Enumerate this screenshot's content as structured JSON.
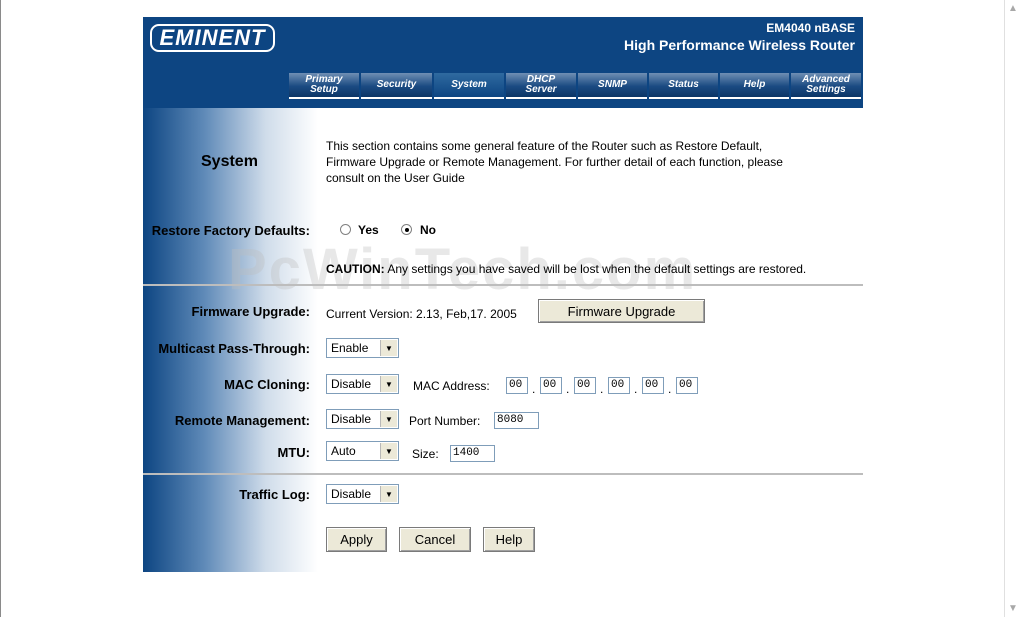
{
  "header": {
    "brand": "EMINENT",
    "model": "EM4040 nBASE",
    "subtitle": "High Performance Wireless Router"
  },
  "tabs": [
    {
      "line1": "Primary",
      "line2": "Setup"
    },
    {
      "line1": "Security",
      "line2": ""
    },
    {
      "line1": "System",
      "line2": ""
    },
    {
      "line1": "DHCP",
      "line2": "Server"
    },
    {
      "line1": "SNMP",
      "line2": ""
    },
    {
      "line1": "Status",
      "line2": ""
    },
    {
      "line1": "Help",
      "line2": ""
    },
    {
      "line1": "Advanced",
      "line2": "Settings"
    }
  ],
  "active_tab": "System",
  "section": {
    "title": "System",
    "description": [
      "This section contains some general feature of the Router such as Restore Default,",
      "Firmware Upgrade or Remote Management. For further detail of each function, please",
      "consult on the User Guide"
    ]
  },
  "restore": {
    "label": "Restore Factory Defaults:",
    "yes": "Yes",
    "no": "No",
    "selected": "No",
    "caution_label": "CAUTION:",
    "caution_text": "Any settings you have saved will be lost when the default settings are restored."
  },
  "firmware": {
    "label": "Firmware Upgrade:",
    "version_text": "Current Version: 2.13, Feb,17. 2005",
    "button": "Firmware Upgrade"
  },
  "multicast": {
    "label": "Multicast Pass-Through:",
    "value": "Enable"
  },
  "mac_cloning": {
    "label": "MAC Cloning:",
    "value": "Disable",
    "mac_label": "MAC Address:",
    "octets": [
      "00",
      "00",
      "00",
      "00",
      "00",
      "00"
    ],
    "separator": "."
  },
  "remote": {
    "label": "Remote Management:",
    "value": "Disable",
    "port_label": "Port Number:",
    "port": "8080"
  },
  "mtu": {
    "label": "MTU:",
    "value": "Auto",
    "size_label": "Size:",
    "size": "1400"
  },
  "traffic": {
    "label": "Traffic Log:",
    "value": "Disable"
  },
  "buttons": {
    "apply": "Apply",
    "cancel": "Cancel",
    "help": "Help"
  },
  "watermark": "PcWinTech.com",
  "colors": {
    "header_bg": "#0d4582",
    "tab_bg": "#1b4b82",
    "button_bg": "#ece9d8"
  }
}
